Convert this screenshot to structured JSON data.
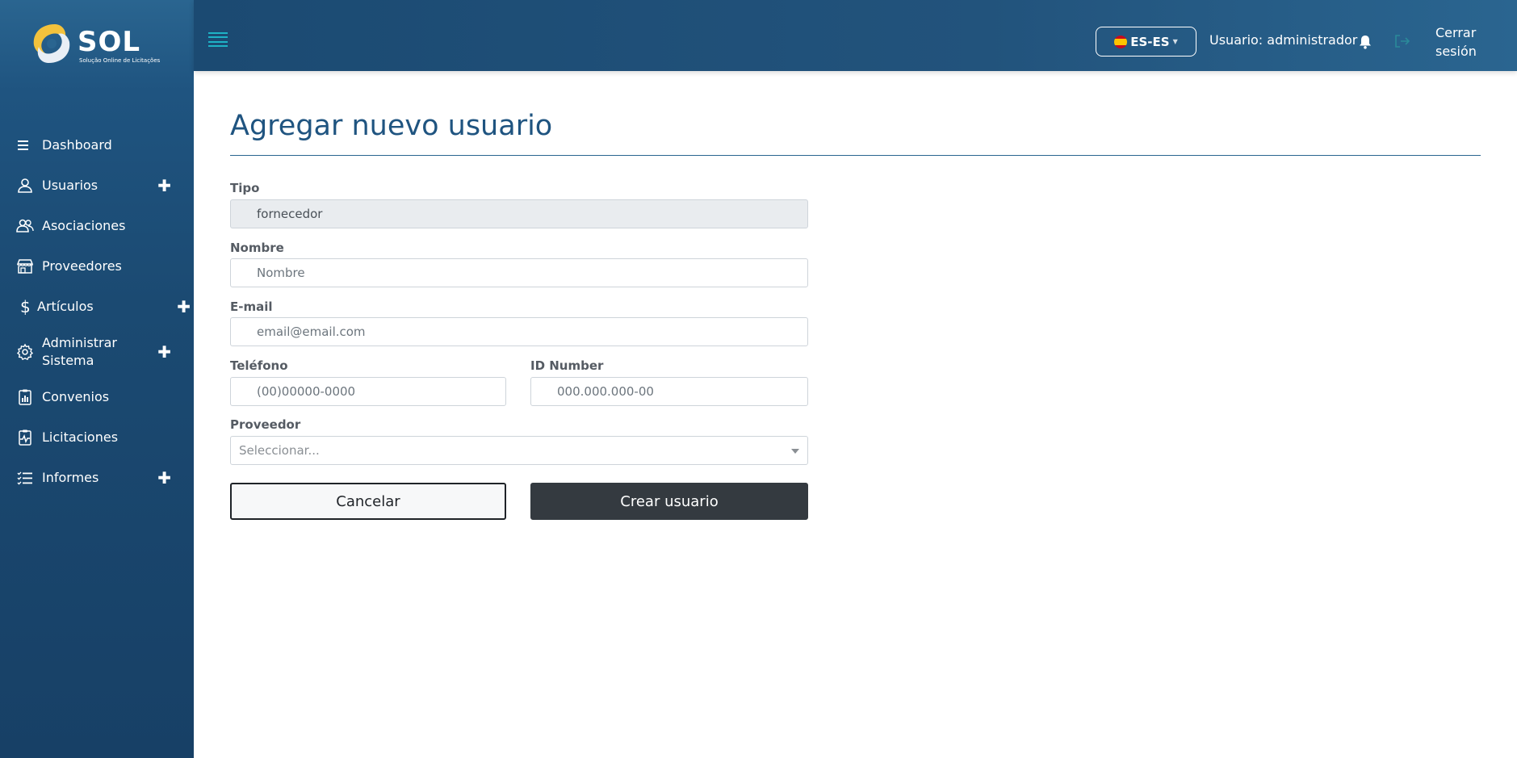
{
  "brand": {
    "name": "SOL",
    "tagline": "Solução Online de Licitações"
  },
  "sidebar": {
    "items": [
      {
        "label": "Dashboard",
        "icon": "list-icon",
        "expandable": false
      },
      {
        "label": "Usuarios",
        "icon": "user-icon",
        "expandable": true
      },
      {
        "label": "Asociaciones",
        "icon": "users-icon",
        "expandable": false
      },
      {
        "label": "Proveedores",
        "icon": "store-icon",
        "expandable": false
      },
      {
        "label": "Artículos",
        "icon": "dollar-icon",
        "expandable": true
      },
      {
        "label": "Administrar Sistema",
        "icon": "gear-icon",
        "expandable": true
      },
      {
        "label": "Convenios",
        "icon": "clipboard-chart-icon",
        "expandable": false
      },
      {
        "label": "Licitaciones",
        "icon": "clipboard-pulse-icon",
        "expandable": false
      },
      {
        "label": "Informes",
        "icon": "checklist-icon",
        "expandable": true
      }
    ],
    "expand_symbol": "✚"
  },
  "header": {
    "language": "ES-ES",
    "user_label": "Usuario: administrador",
    "logout_label": "Cerrar sesión"
  },
  "form": {
    "title": "Agregar nuevo usuario",
    "tipo_label": "Tipo",
    "tipo_value": "fornecedor",
    "nombre_label": "Nombre",
    "nombre_placeholder": "Nombre",
    "email_label": "E-mail",
    "email_placeholder": "email@email.com",
    "telefono_label": "Teléfono",
    "telefono_placeholder": "(00)00000-0000",
    "id_label": "ID Number",
    "id_placeholder": "000.000.000-00",
    "proveedor_label": "Proveedor",
    "proveedor_placeholder": "Seleccionar...",
    "cancel_label": "Cancelar",
    "create_label": "Crear usuario"
  },
  "colors": {
    "sidebar_bg": "#1b4a72",
    "header_bg": "#22537c",
    "title": "#1f5480",
    "accent": "#1eb3c7",
    "primary_button": "#343a40"
  }
}
